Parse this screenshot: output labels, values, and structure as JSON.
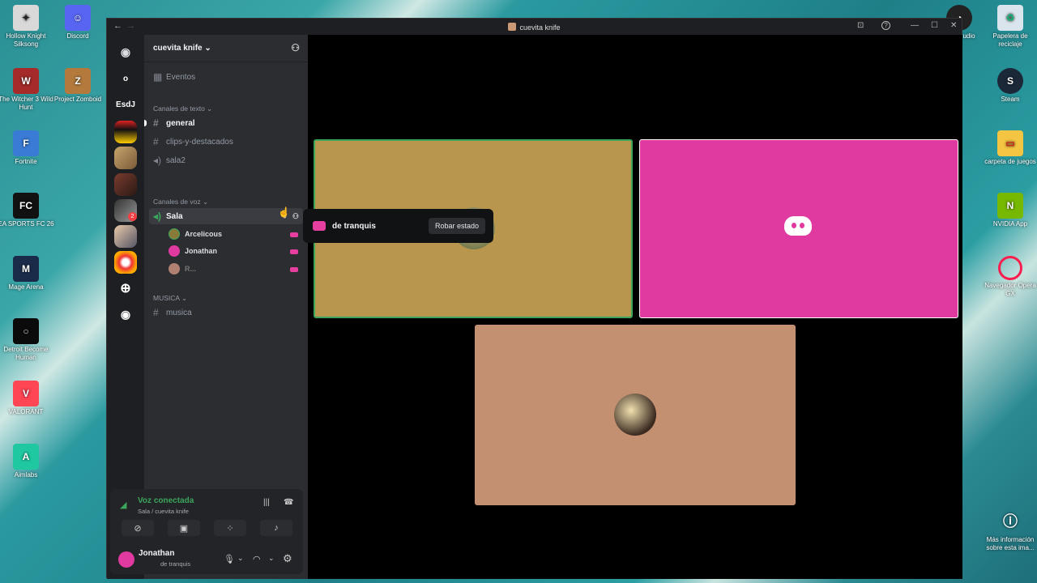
{
  "desktop": {
    "icons_left": [
      {
        "label": "Hollow Knight Silksong",
        "glyph": "✦",
        "bg": "#d9d9d9"
      },
      {
        "label": "The Witcher 3 Wild Hunt",
        "glyph": "W",
        "bg": "#a52a2a"
      },
      {
        "label": "Fortnite",
        "glyph": "F",
        "bg": "#3a7bd5"
      },
      {
        "label": "EA SPORTS FC 26",
        "glyph": "FC",
        "bg": "#111"
      },
      {
        "label": "Mage Arena",
        "glyph": "M",
        "bg": "#1a2b4a"
      },
      {
        "label": "Detroit Become Human",
        "glyph": "○",
        "bg": "#0b0b0b"
      },
      {
        "label": "VALORANT",
        "glyph": "V",
        "bg": "#ff4655"
      },
      {
        "label": "Aimlabs",
        "glyph": "A",
        "bg": "#1fc8a0"
      }
    ],
    "icons_left2": [
      {
        "label": "Discord",
        "glyph": "☺",
        "bg": "#5865f2"
      },
      {
        "label": "Project Zomboid",
        "glyph": "Z",
        "bg": "#b37a3c"
      }
    ],
    "icons_right": [
      {
        "label": "Papelera de reciclaje",
        "glyph": "♻",
        "bg": "#d9e4ec"
      },
      {
        "label": "Steam",
        "glyph": "S",
        "bg": "#1b2838"
      },
      {
        "label": "carpeta de juegos",
        "glyph": "▭",
        "bg": "#f4c542"
      },
      {
        "label": "NVIDIA App",
        "glyph": "N",
        "bg": "#76b900"
      },
      {
        "label": "Navegador Opera GX",
        "glyph": "O",
        "bg": "#fa1e4e"
      },
      {
        "label": "Más información sobre esta ima...",
        "glyph": "ⓘ",
        "bg": "#333"
      }
    ],
    "partial_label": "udio"
  },
  "window": {
    "title": "cuevita knife",
    "back": "←",
    "fwd": "→",
    "inbox_icon": "⊡",
    "help_icon": "?",
    "minimize": "—",
    "maximize": "☐",
    "close": "✕"
  },
  "servers": [
    {
      "label": "◉",
      "bg": "#2b2d31"
    },
    {
      "label": "o",
      "bg": "#2b2d31"
    },
    {
      "label": "EsdJ",
      "bg": "#2b2d31"
    }
  ],
  "server_badge": "2",
  "channels": {
    "server_name": "cuevita knife",
    "chevron": "⌄",
    "events_label": "Eventos",
    "text_category": "Canales de texto",
    "text_channels": [
      "general",
      "clips-y-destacados"
    ],
    "sala2": "sala2",
    "voice_category": "Canales de voz",
    "voice_channel": "Sala",
    "members": [
      "Arcelicous",
      "Jonathan",
      "R..."
    ],
    "music_category": "MUSICA",
    "music_channel": "musica"
  },
  "voice": {
    "status": "Voz conectada",
    "location": "Sala / cuevita knife"
  },
  "user": {
    "name": "Jonathan",
    "status": "de tranquis"
  },
  "tooltip": {
    "activity": "de tranquis",
    "button": "Robar estado"
  },
  "colors": {
    "tile1": "#b8964e",
    "tile2": "#e03aa0",
    "tile3": "#c39072",
    "speaking": "#3ba55c",
    "discord_blurple": "#5865f2"
  }
}
